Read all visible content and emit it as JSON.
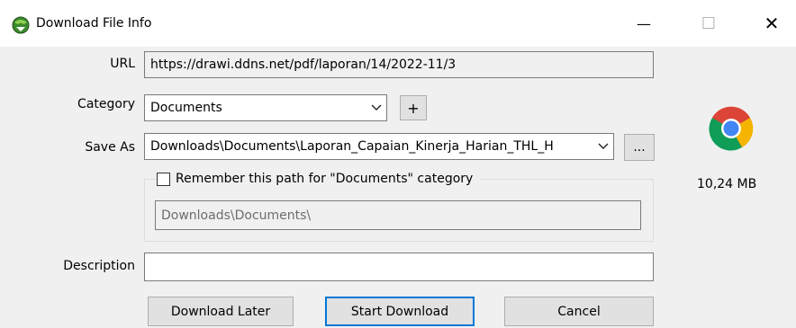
{
  "window": {
    "title": "Download File Info",
    "minimize": "—",
    "maximize": "☐",
    "close": "✕"
  },
  "url": {
    "label": "URL",
    "value": "https://drawi.ddns.net/pdf/laporan/14/2022-11/3"
  },
  "category": {
    "label": "Category",
    "value": "Documents",
    "add_label": "+"
  },
  "save_as": {
    "label": "Save As",
    "value": "Downloads\\Documents\\Laporan_Capaian_Kinerja_Harian_THL_H",
    "browse_label": "..."
  },
  "remember": {
    "label": "Remember this path for \"Documents\" category",
    "checked": false,
    "path": "Downloads\\Documents\\"
  },
  "description": {
    "label": "Description",
    "value": ""
  },
  "file": {
    "size": "10,24 MB",
    "icon": "chrome-icon"
  },
  "buttons": {
    "download_later": "Download Later",
    "start_download": "Start Download",
    "cancel": "Cancel"
  },
  "colors": {
    "default_button_border": "#0078d7",
    "background": "#f0f0f0"
  }
}
